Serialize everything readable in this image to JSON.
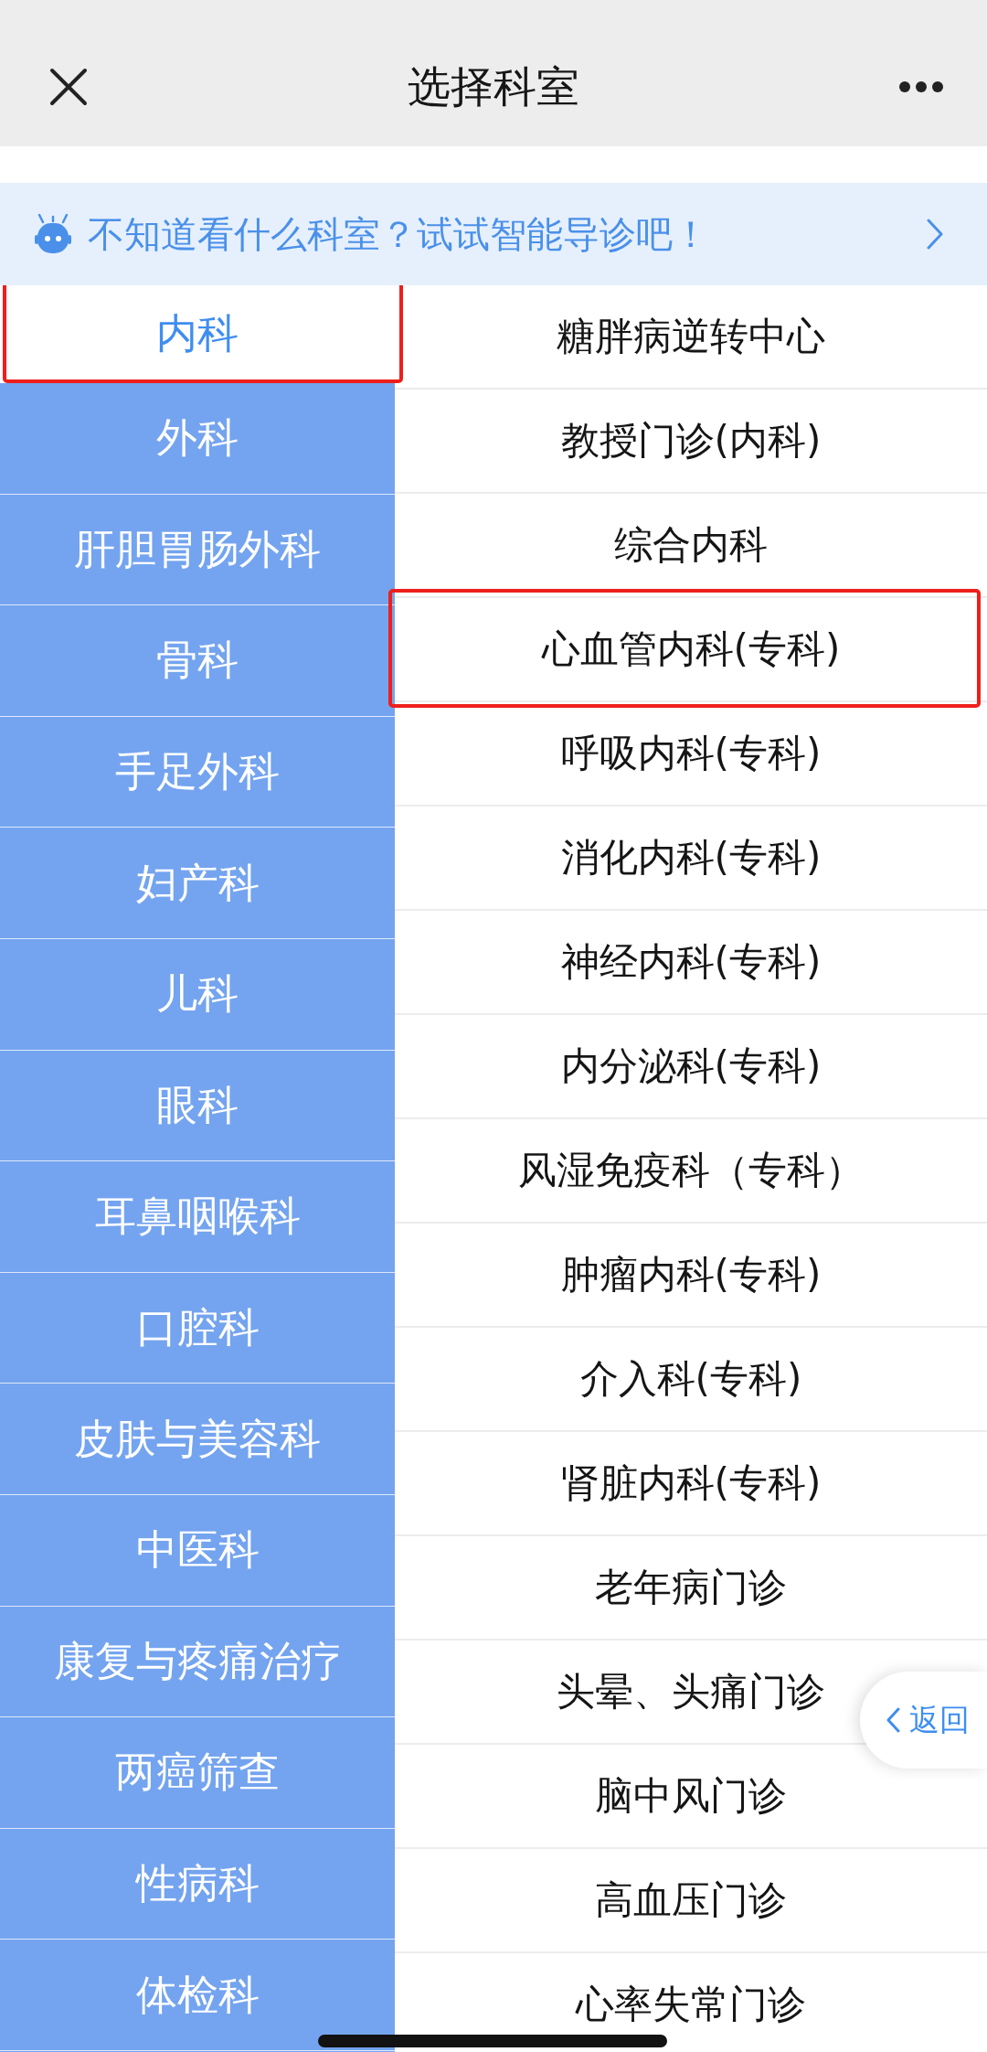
{
  "header": {
    "title": "选择科室"
  },
  "banner": {
    "text": "不知道看什么科室？试试智能导诊吧！"
  },
  "departments": [
    {
      "label": "内科",
      "selected": true,
      "highlighted": true
    },
    {
      "label": "外科",
      "selected": false,
      "highlighted": false
    },
    {
      "label": "肝胆胃肠外科",
      "selected": false,
      "highlighted": false
    },
    {
      "label": "骨科",
      "selected": false,
      "highlighted": false
    },
    {
      "label": "手足外科",
      "selected": false,
      "highlighted": false
    },
    {
      "label": "妇产科",
      "selected": false,
      "highlighted": false
    },
    {
      "label": "儿科",
      "selected": false,
      "highlighted": false
    },
    {
      "label": "眼科",
      "selected": false,
      "highlighted": false
    },
    {
      "label": "耳鼻咽喉科",
      "selected": false,
      "highlighted": false
    },
    {
      "label": "口腔科",
      "selected": false,
      "highlighted": false
    },
    {
      "label": "皮肤与美容科",
      "selected": false,
      "highlighted": false
    },
    {
      "label": "中医科",
      "selected": false,
      "highlighted": false
    },
    {
      "label": "康复与疼痛治疗",
      "selected": false,
      "highlighted": false
    },
    {
      "label": "两癌筛查",
      "selected": false,
      "highlighted": false
    },
    {
      "label": "性病科",
      "selected": false,
      "highlighted": false
    },
    {
      "label": "体检科",
      "selected": false,
      "highlighted": false
    }
  ],
  "clinics": [
    {
      "label": "糖胖病逆转中心",
      "highlighted": false
    },
    {
      "label": "教授门诊(内科)",
      "highlighted": false
    },
    {
      "label": "综合内科",
      "highlighted": false
    },
    {
      "label": "心血管内科(专科)",
      "highlighted": true
    },
    {
      "label": "呼吸内科(专科)",
      "highlighted": false
    },
    {
      "label": "消化内科(专科)",
      "highlighted": false
    },
    {
      "label": "神经内科(专科)",
      "highlighted": false
    },
    {
      "label": "内分泌科(专科)",
      "highlighted": false
    },
    {
      "label": "风湿免疫科（专科）",
      "highlighted": false
    },
    {
      "label": "肿瘤内科(专科)",
      "highlighted": false
    },
    {
      "label": "介入科(专科)",
      "highlighted": false
    },
    {
      "label": "肾脏内科(专科)",
      "highlighted": false
    },
    {
      "label": "老年病门诊",
      "highlighted": false
    },
    {
      "label": "头晕、头痛门诊",
      "highlighted": false
    },
    {
      "label": "脑中风门诊",
      "highlighted": false
    },
    {
      "label": "高血压门诊",
      "highlighted": false
    },
    {
      "label": "心率失常门诊",
      "highlighted": false
    }
  ],
  "back_button": {
    "label": "返回"
  }
}
